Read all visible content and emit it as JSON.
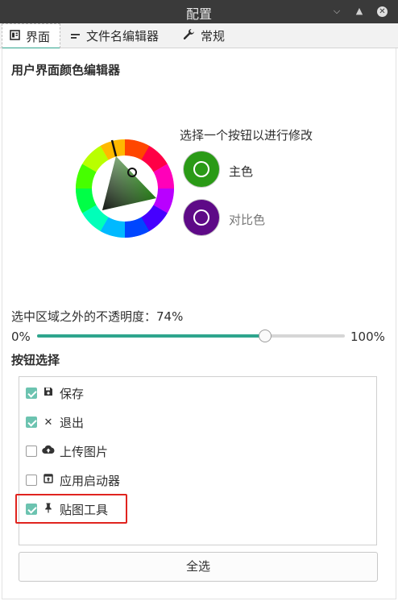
{
  "window": {
    "title": "配置",
    "controls": [
      "minimize-icon",
      "maximize-icon",
      "close-icon"
    ]
  },
  "tabs": [
    {
      "label": "界面",
      "icon": "interface-icon",
      "active": true
    },
    {
      "label": "文件名编辑器",
      "icon": "text-lines-icon",
      "active": false
    },
    {
      "label": "常规",
      "icon": "wrench-icon",
      "active": false
    }
  ],
  "ui_editor": {
    "section_title": "用户界面颜色编辑器",
    "prompt": "选择一个按钮以进行修改",
    "main_color": {
      "label": "主色",
      "color": "#2a9a16"
    },
    "contrast_color": {
      "label": "对比色",
      "color": "#5e0a87"
    }
  },
  "opacity": {
    "label": "选中区域之外的不透明度：74%",
    "min_label": "0%",
    "max_label": "100%",
    "value": 74,
    "accent": "#2ea58d"
  },
  "buttons": {
    "section_title": "按钮选择",
    "items": [
      {
        "label": "保存",
        "icon": "save-icon",
        "checked": true
      },
      {
        "label": "退出",
        "icon": "close-x-icon",
        "checked": true
      },
      {
        "label": "上传图片",
        "icon": "cloud-upload-icon",
        "checked": false
      },
      {
        "label": "应用启动器",
        "icon": "app-launcher-icon",
        "checked": false
      },
      {
        "label": "贴图工具",
        "icon": "pin-icon",
        "checked": true
      }
    ],
    "select_all_label": "全选"
  }
}
